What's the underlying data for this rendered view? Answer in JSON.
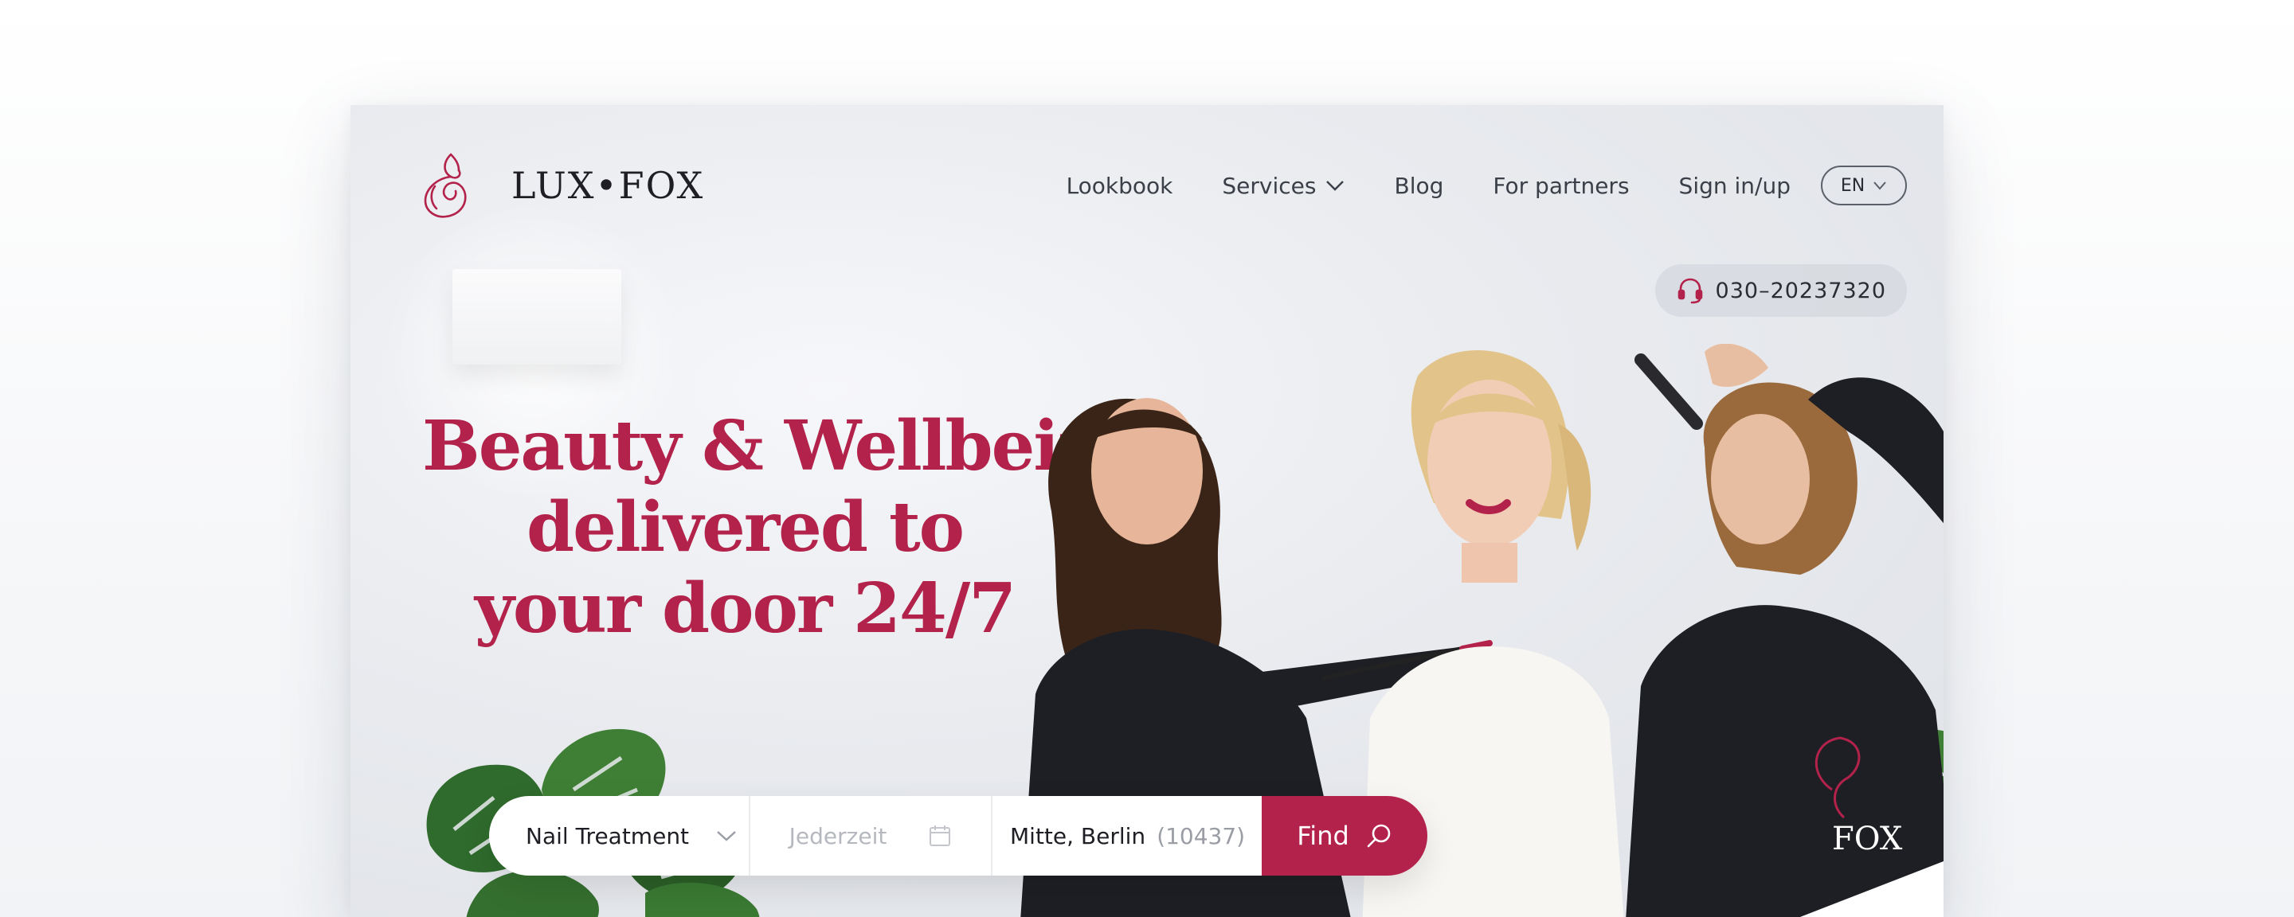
{
  "brand": {
    "name": "LUX•FOX",
    "accent": "#b3224a"
  },
  "nav": {
    "items": [
      {
        "label": "Lookbook"
      },
      {
        "label": "Services"
      },
      {
        "label": "Blog"
      },
      {
        "label": "For partners"
      },
      {
        "label": "Sign in/up"
      }
    ],
    "language": "EN"
  },
  "contact": {
    "phone": "030–20237320",
    "icon": "headset-icon"
  },
  "hero": {
    "headline": [
      "Beauty & Wellbeing",
      "delivered to",
      "your door 24/7"
    ]
  },
  "search": {
    "service": "Nail Treatment",
    "date_placeholder": "Jederzeit",
    "location": "Mitte, Berlin",
    "postcode": "(10437)",
    "find_label": "Find"
  },
  "apron_logo_text": "FOX"
}
